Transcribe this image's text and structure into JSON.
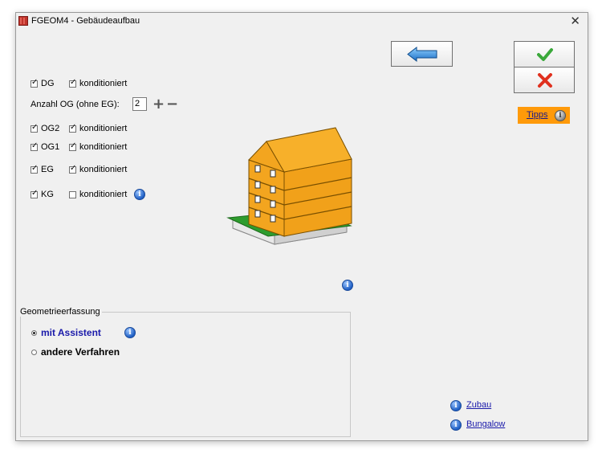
{
  "window": {
    "title": "FGEOM4 - Gebäudeaufbau",
    "close_glyph": "✕"
  },
  "floors": {
    "dg": {
      "label": "DG",
      "checked": true,
      "conditioned_label": "konditioniert",
      "conditioned": true
    },
    "count_label": "Anzahl OG (ohne EG):",
    "count_value": "2",
    "og2": {
      "label": "OG2",
      "checked": true,
      "conditioned_label": "konditioniert",
      "conditioned": true
    },
    "og1": {
      "label": "OG1",
      "checked": true,
      "conditioned_label": "konditioniert",
      "conditioned": true
    },
    "eg": {
      "label": "EG",
      "checked": true,
      "conditioned_label": "konditioniert",
      "conditioned": true
    },
    "kg": {
      "label": "KG",
      "checked": true,
      "conditioned_label": "konditioniert",
      "conditioned": false
    }
  },
  "buttons": {
    "back_icon": "arrow-left-icon",
    "ok_icon": "checkmark-icon",
    "cancel_icon": "cross-icon"
  },
  "tipps": {
    "label": "Tipps"
  },
  "geometry": {
    "group_title": "Geometrieerfassung",
    "options": [
      {
        "label": "mit Assistent",
        "selected": true
      },
      {
        "label": "andere Verfahren",
        "selected": false
      }
    ]
  },
  "links": {
    "zubau": "Zubau",
    "bungalow": "Bungalow"
  },
  "colors": {
    "building": "#f3a51f",
    "ground": "#2e9c2e",
    "tipps_bg": "#ff9a0a",
    "link": "#1a1aaa",
    "assistant_text": "#1a1aaa"
  }
}
